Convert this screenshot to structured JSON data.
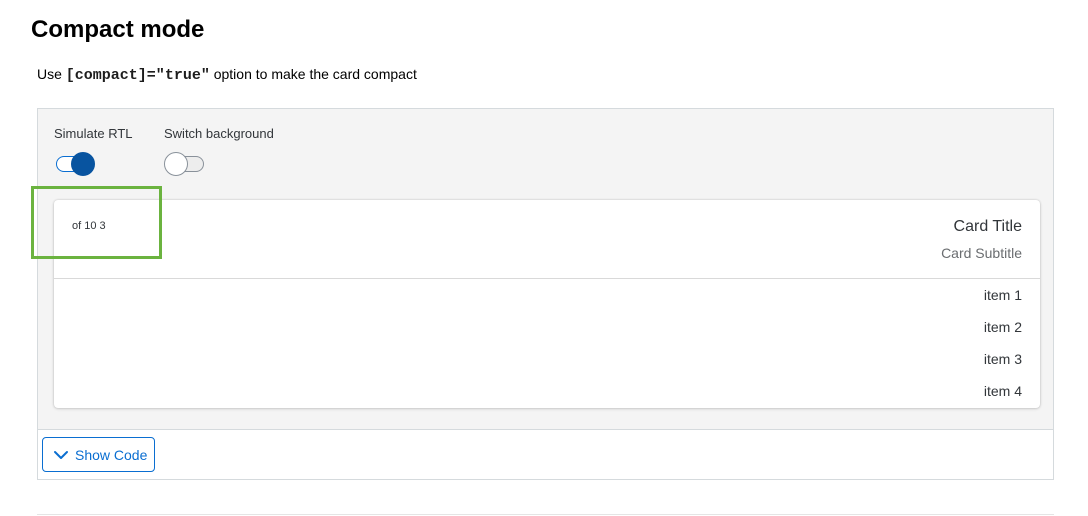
{
  "section": {
    "title": "Compact mode",
    "description_prefix": "Use ",
    "description_code": "[compact]=\"true\"",
    "description_suffix": " option to make the card compact"
  },
  "controls": {
    "rtl_label": "Simulate RTL",
    "rtl_on": true,
    "background_label": "Switch background",
    "background_on": false
  },
  "card": {
    "counter": "of 10 3",
    "title": "Card Title",
    "subtitle": "Card Subtitle",
    "items": [
      "item 1",
      "item 2",
      "item 3",
      "item 4"
    ]
  },
  "footer": {
    "show_code_label": "Show Code"
  },
  "colors": {
    "accent": "#0a6ed1",
    "highlight": "#6bb33f"
  }
}
